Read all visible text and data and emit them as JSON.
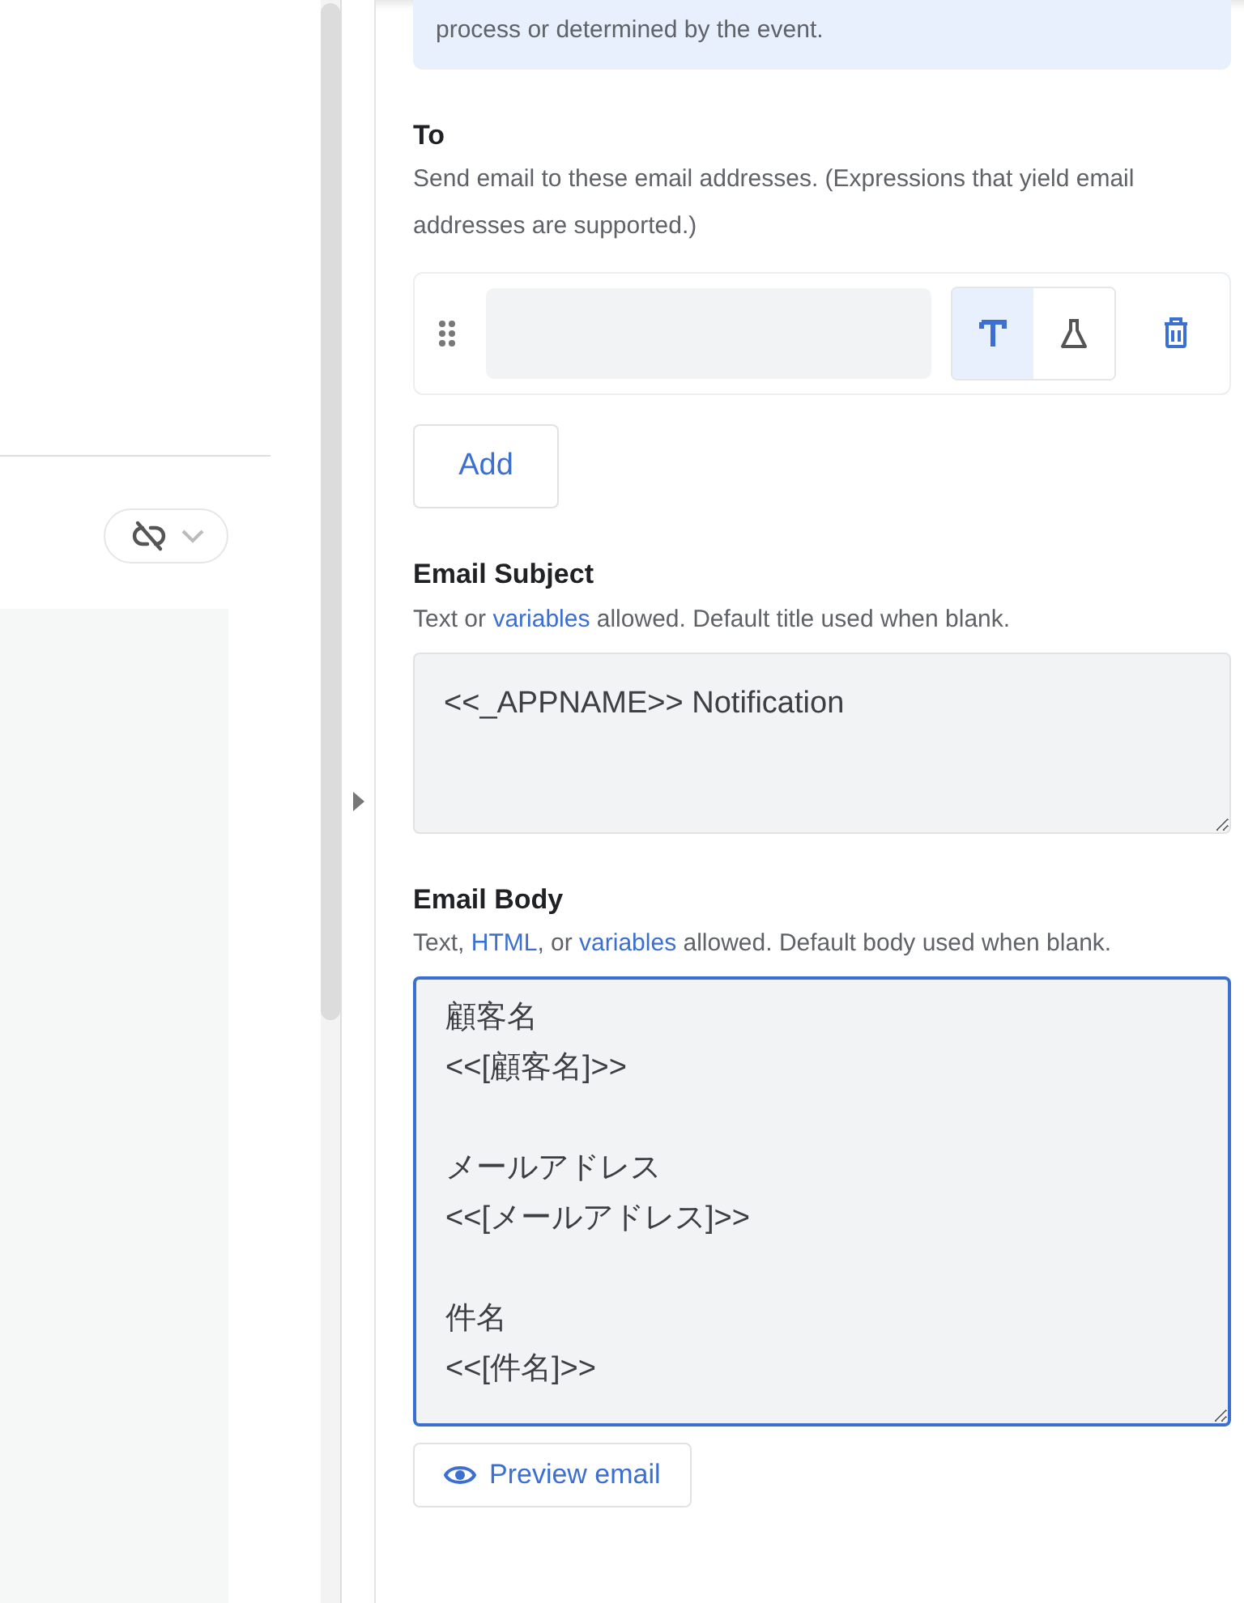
{
  "link_toggle": {
    "linked": false
  },
  "info_note": {
    "text": "process or determined by the event."
  },
  "to": {
    "label": "To",
    "help": "Send email to these email addresses. (Expressions that yield email addresses are supported.)",
    "recipients": [
      {
        "modes": [
          {
            "kind": "text",
            "selected": true
          },
          {
            "kind": "expression",
            "selected": false
          }
        ]
      }
    ],
    "add_button": "Add"
  },
  "subject": {
    "label": "Email Subject",
    "help": [
      {
        "text": "Text or "
      },
      {
        "text": "variables",
        "link": true
      },
      {
        "text": " allowed. Default title used when blank."
      }
    ],
    "value": "<<_APPNAME>> Notification"
  },
  "body": {
    "label": "Email Body",
    "help": [
      {
        "text": "Text, "
      },
      {
        "text": "HTML",
        "link": true
      },
      {
        "text": ", or "
      },
      {
        "text": "variables",
        "link": true
      },
      {
        "text": " allowed. Default body used when blank."
      }
    ],
    "value": "顧客名\n<<[顧客名]>>\n\nメールアドレス\n<<[メールアドレス]>>\n\n件名\n<<[件名]>>",
    "focused": true
  },
  "preview_button": "Preview email"
}
